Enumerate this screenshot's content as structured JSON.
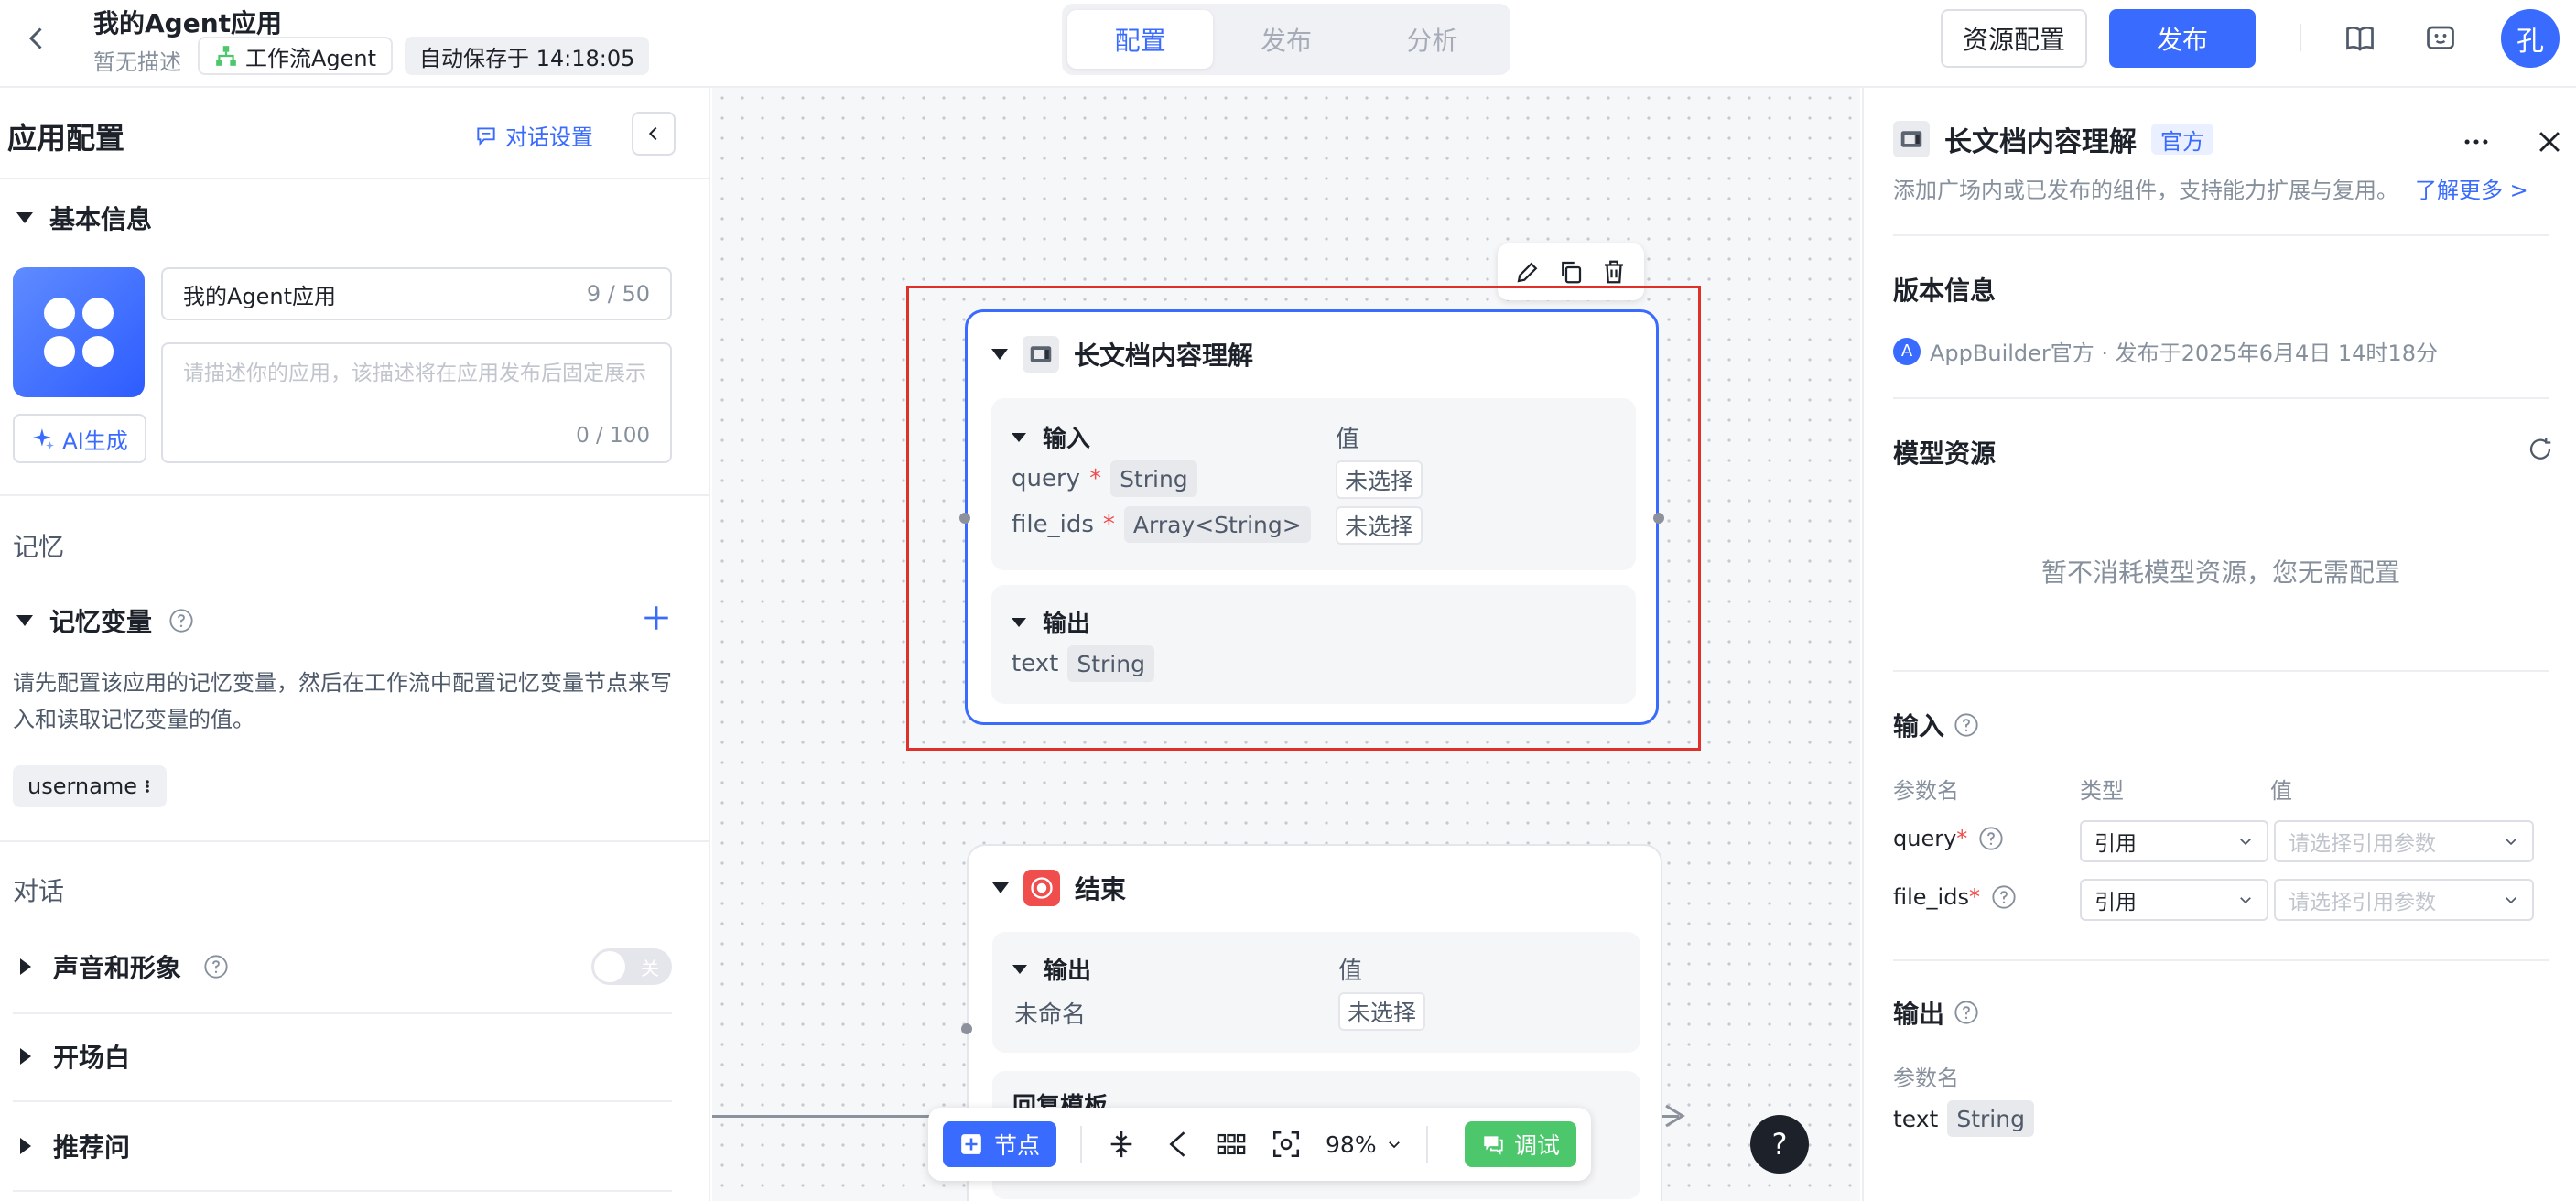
{
  "header": {
    "app_title": "我的Agent应用",
    "app_desc": "暂无描述",
    "app_type": "工作流Agent",
    "autosave": "自动保存于 14:18:05",
    "tabs": [
      "配置",
      "发布",
      "分析"
    ],
    "active_tab": "配置",
    "resource_button": "资源配置",
    "publish_button": "发布",
    "avatar_initial": "孔"
  },
  "left": {
    "title": "应用配置",
    "chat_settings": "对话设置",
    "basic_info": "基本信息",
    "name_value": "我的Agent应用",
    "name_count": "9 / 50",
    "desc_placeholder": "请描述你的应用，该描述将在应用发布后固定展示",
    "desc_count": "0 / 100",
    "ai_generate": "AI生成",
    "memory_group": "记忆",
    "memory_vars": "记忆变量",
    "memory_desc": "请先配置该应用的记忆变量，然后在工作流中配置记忆变量节点来写入和读取记忆变量的值。",
    "memory_var_chip": "username",
    "dialog_group": "对话",
    "voice": "声音和形象",
    "voice_toggle": "关",
    "opening": "开场白",
    "recommend": "推荐问"
  },
  "canvas": {
    "main_node": {
      "title": "长文档内容理解",
      "input_label": "输入",
      "value_label": "值",
      "params": [
        {
          "name": "query",
          "type": "String",
          "value": "未选择"
        },
        {
          "name": "file_ids",
          "type": "Array<String>",
          "value": "未选择"
        }
      ],
      "output_label": "输出",
      "outputs": [
        {
          "name": "text",
          "type": "String"
        }
      ]
    },
    "end_node": {
      "title": "结束",
      "output_label": "输出",
      "value_label": "值",
      "output_name": "未命名",
      "output_value": "未选择",
      "reply_template": "回复模板"
    },
    "toolbar": {
      "add_node": "节点",
      "zoom": "98%",
      "debug": "调试"
    },
    "help": "?"
  },
  "right": {
    "title": "长文档内容理解",
    "badge": "官方",
    "desc": "添加广场内或已发布的组件，支持能力扩展与复用。",
    "learn_more": "了解更多 >",
    "version_title": "版本信息",
    "publisher_initial": "A",
    "publisher": "AppBuilder官方 · 发布于2025年6月4日 14时18分",
    "model_title": "模型资源",
    "model_empty": "暂不消耗模型资源，您无需配置",
    "input_title": "输入",
    "col_name": "参数名",
    "col_type": "类型",
    "col_value": "值",
    "inputs": [
      {
        "name": "query",
        "type": "引用",
        "placeholder": "请选择引用参数"
      },
      {
        "name": "file_ids",
        "type": "引用",
        "placeholder": "请选择引用参数"
      }
    ],
    "output_title": "输出",
    "output_col": "参数名",
    "output_name": "text",
    "output_type": "String"
  },
  "colors": {
    "accent": "#3a6bff",
    "selection_frame": "#e0302a",
    "debug_green": "#4cc76b",
    "end_red": "#f04d4d"
  }
}
